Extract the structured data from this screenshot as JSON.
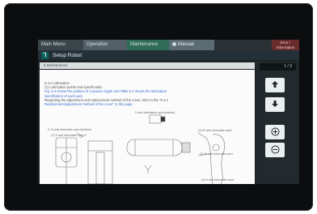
{
  "tabs": {
    "main_menu": "Main Menu",
    "operation": "Operation",
    "maintenance": "Maintenance",
    "manual": "Manual",
    "information": "Error / Information"
  },
  "header": {
    "title": "Setup Robot",
    "icon": "robot-setup-icon"
  },
  "document": {
    "section_header": "5 Maintenance",
    "lines": [
      "5.4.4 Lubrication",
      "(1) Lubrication points and specification",
      "Fig. 5-4 shows the position of a grease nipple and Table 5-4 shows the lubrication",
      "specification of each axis.",
      "Regarding the adjustment and replacement method of the cover, refer to the \"5.4.2",
      "Replacement/adjustment method of the cover\" in this page."
    ],
    "captions": {
      "top": "S axis lubrication spot (bottom)",
      "left_a": "S, B axis lubrication spot (Bottom)",
      "left_b": "(1) S axis lubrication port",
      "right_a": "(2) W axis lubrication spot",
      "right_b": "(2) W axis lubrication port",
      "bottom_right": "(3) B axis lubrication spot"
    }
  },
  "side": {
    "page": "1 / 2",
    "up_icon": "arrow-up-icon",
    "down_icon": "arrow-down-icon",
    "zoom_in_icon": "zoom-in-icon",
    "zoom_out_icon": "zoom-out-icon"
  },
  "colors": {
    "maintenance_tab": "#2f6b56",
    "info_button": "#6a2b2b",
    "link_text": "#3a6fd0"
  }
}
